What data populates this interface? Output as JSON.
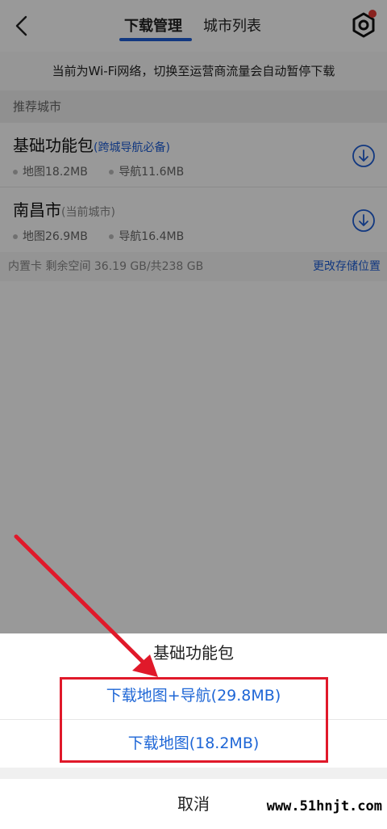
{
  "header": {
    "tabs": [
      {
        "label": "下载管理",
        "active": true
      },
      {
        "label": "城市列表",
        "active": false
      }
    ],
    "accent_color": "#1e5ed6"
  },
  "notice": "当前为Wi-Fi网络，切换至运营商流量会自动暂停下载",
  "section_title": "推荐城市",
  "cities": [
    {
      "name": "基础功能包",
      "tag": "(跨城导航必备)",
      "map": "地图18.2MB",
      "nav": "导航11.6MB"
    },
    {
      "name": "南昌市",
      "tag": "(当前城市)",
      "map": "地图26.9MB",
      "nav": "导航16.4MB"
    }
  ],
  "storage": {
    "text": "内置卡 剩余空间 36.19 GB/共238 GB",
    "link": "更改存储位置"
  },
  "sheet": {
    "title": "基础功能包",
    "option1": "下载地图+导航(29.8MB)",
    "option2": "下载地图(18.2MB)",
    "cancel": "取消"
  },
  "watermark": "www.51hnjt.com"
}
